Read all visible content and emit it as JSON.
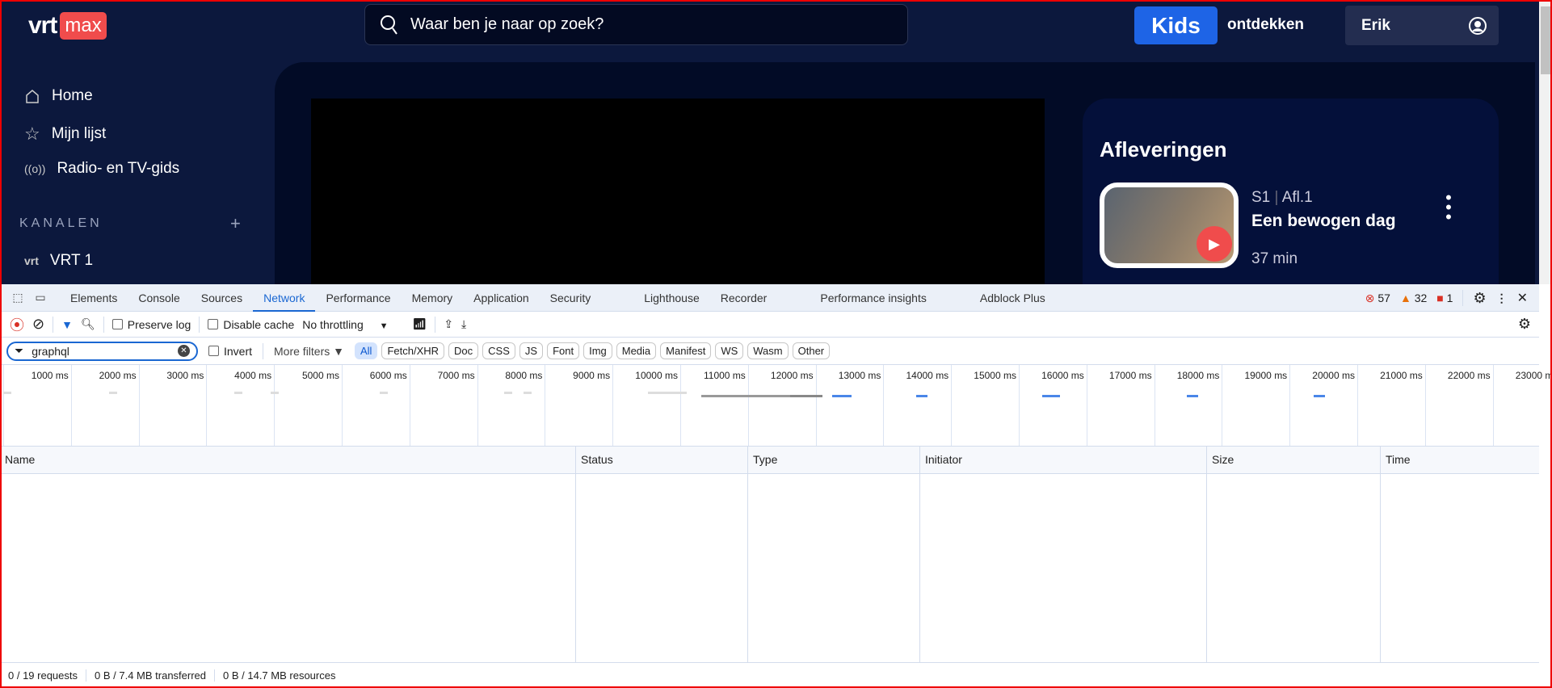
{
  "site": {
    "logo_vrt": "vrt",
    "logo_max": "max",
    "search_placeholder": "Waar ben je naar op zoek?",
    "kids": "Kids",
    "discover": "ontdekken",
    "user": "Erik",
    "nav": [
      {
        "label": "Home",
        "icon": "home-icon"
      },
      {
        "label": "Mijn lijst",
        "icon": "star-icon"
      },
      {
        "label": "Radio- en TV-gids",
        "icon": "radio-icon"
      }
    ],
    "channels_heading": "KANALEN",
    "channels_add": "+",
    "channels": [
      {
        "label": "VRT 1"
      }
    ],
    "episodes": {
      "heading": "Afleveringen",
      "season": "S1",
      "episode": "Afl.1",
      "title": "Een bewogen dag",
      "duration": "37 min"
    }
  },
  "devtools": {
    "tabs": [
      "Elements",
      "Console",
      "Sources",
      "Network",
      "Performance",
      "Memory",
      "Application",
      "Security",
      "Lighthouse",
      "Recorder",
      "Performance insights",
      "Adblock Plus"
    ],
    "active_tab": "Network",
    "errors": "57",
    "warnings": "32",
    "issues": "1",
    "toolbar": {
      "preserve_log": "Preserve log",
      "disable_cache": "Disable cache",
      "throttling": "No throttling"
    },
    "filter": {
      "value": "graphql",
      "invert": "Invert",
      "more_filters": "More filters"
    },
    "type_filters": [
      "All",
      "Fetch/XHR",
      "Doc",
      "CSS",
      "JS",
      "Font",
      "Img",
      "Media",
      "Manifest",
      "WS",
      "Wasm",
      "Other"
    ],
    "active_type": "All",
    "timeline_ticks": [
      "1000 ms",
      "2000 ms",
      "3000 ms",
      "4000 ms",
      "5000 ms",
      "6000 ms",
      "7000 ms",
      "8000 ms",
      "9000 ms",
      "10000 ms",
      "11000 ms",
      "12000 ms",
      "13000 ms",
      "14000 ms",
      "15000 ms",
      "16000 ms",
      "17000 ms",
      "18000 ms",
      "19000 ms",
      "20000 ms",
      "21000 ms",
      "22000 ms",
      "23000 ms"
    ],
    "columns": [
      "Name",
      "Status",
      "Type",
      "Initiator",
      "Size",
      "Time"
    ],
    "status": {
      "requests": "0 / 19 requests",
      "transferred": "0 B / 7.4 MB transferred",
      "resources": "0 B / 14.7 MB resources"
    }
  }
}
